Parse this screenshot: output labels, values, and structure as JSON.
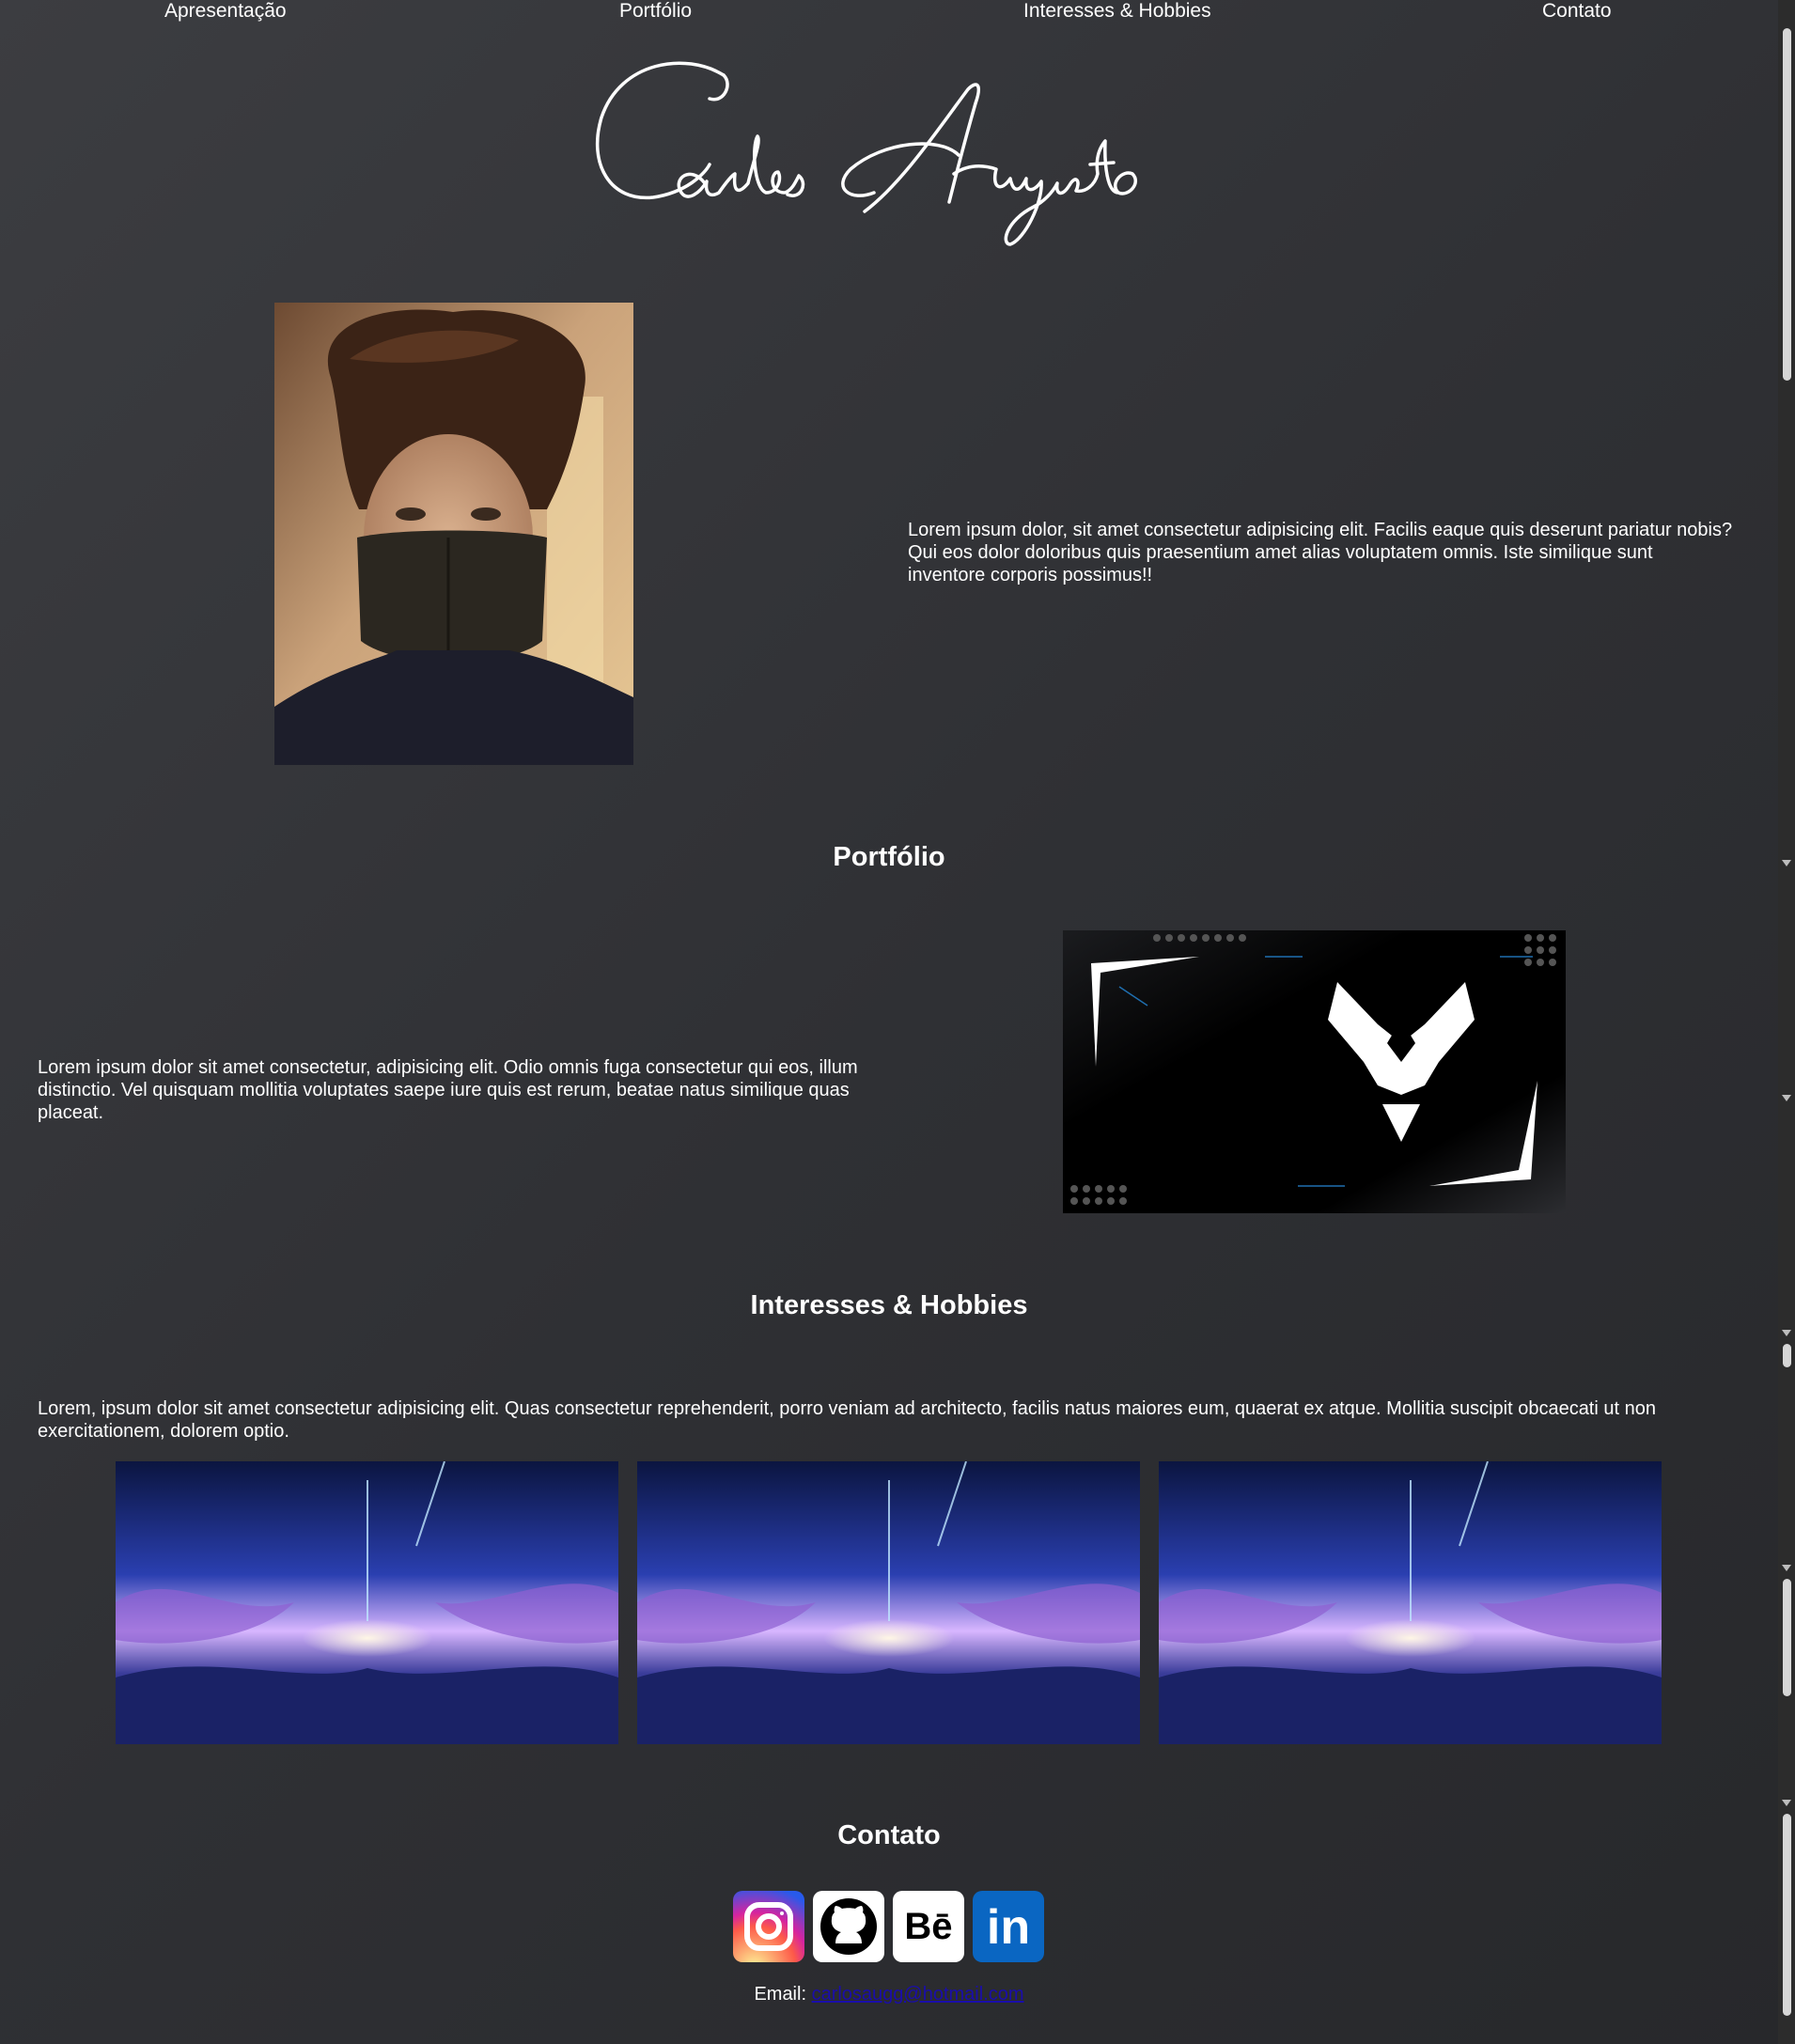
{
  "nav": {
    "items": [
      {
        "label": "Apresentação"
      },
      {
        "label": "Portfólio"
      },
      {
        "label": "Interesses & Hobbies"
      },
      {
        "label": "Contato"
      }
    ]
  },
  "signature": {
    "text": "Carlos Augusto"
  },
  "intro": {
    "text": "Lorem ipsum dolor, sit amet consectetur adipisicing elit. Facilis eaque quis deserunt pariatur nobis? Qui eos dolor doloribus quis praesentium amet alias voluptatem omnis. Iste similique sunt inventore corporis possimus!!"
  },
  "portfolio": {
    "title": "Portfólio",
    "text": "Lorem ipsum dolor sit amet consectetur, adipisicing elit. Odio omnis fuga consectetur qui eos, illum distinctio. Vel quisquam mollitia voluptates saepe iure quis est rerum, beatae natus similique quas placeat."
  },
  "hobbies": {
    "title": "Interesses & Hobbies",
    "text": "Lorem, ipsum dolor sit amet consectetur adipisicing elit. Quas consectetur reprehenderit, porro veniam ad architecto, facilis natus maiores eum, quaerat ex atque. Mollitia suscipit obcaecati ut non exercitationem, dolorem optio."
  },
  "contact": {
    "title": "Contato",
    "email_label": "Email:",
    "email_value": "carlosaugg@hotmail.com",
    "socials": [
      {
        "icon": "instagram-icon"
      },
      {
        "icon": "github-icon"
      },
      {
        "icon": "behance-icon",
        "label": "Bē"
      },
      {
        "icon": "linkedin-icon",
        "label": "in"
      }
    ]
  },
  "colors": {
    "background": "#313236",
    "text": "#ffffff",
    "link": "#1a0dab",
    "linkedin": "#0a66c2"
  }
}
